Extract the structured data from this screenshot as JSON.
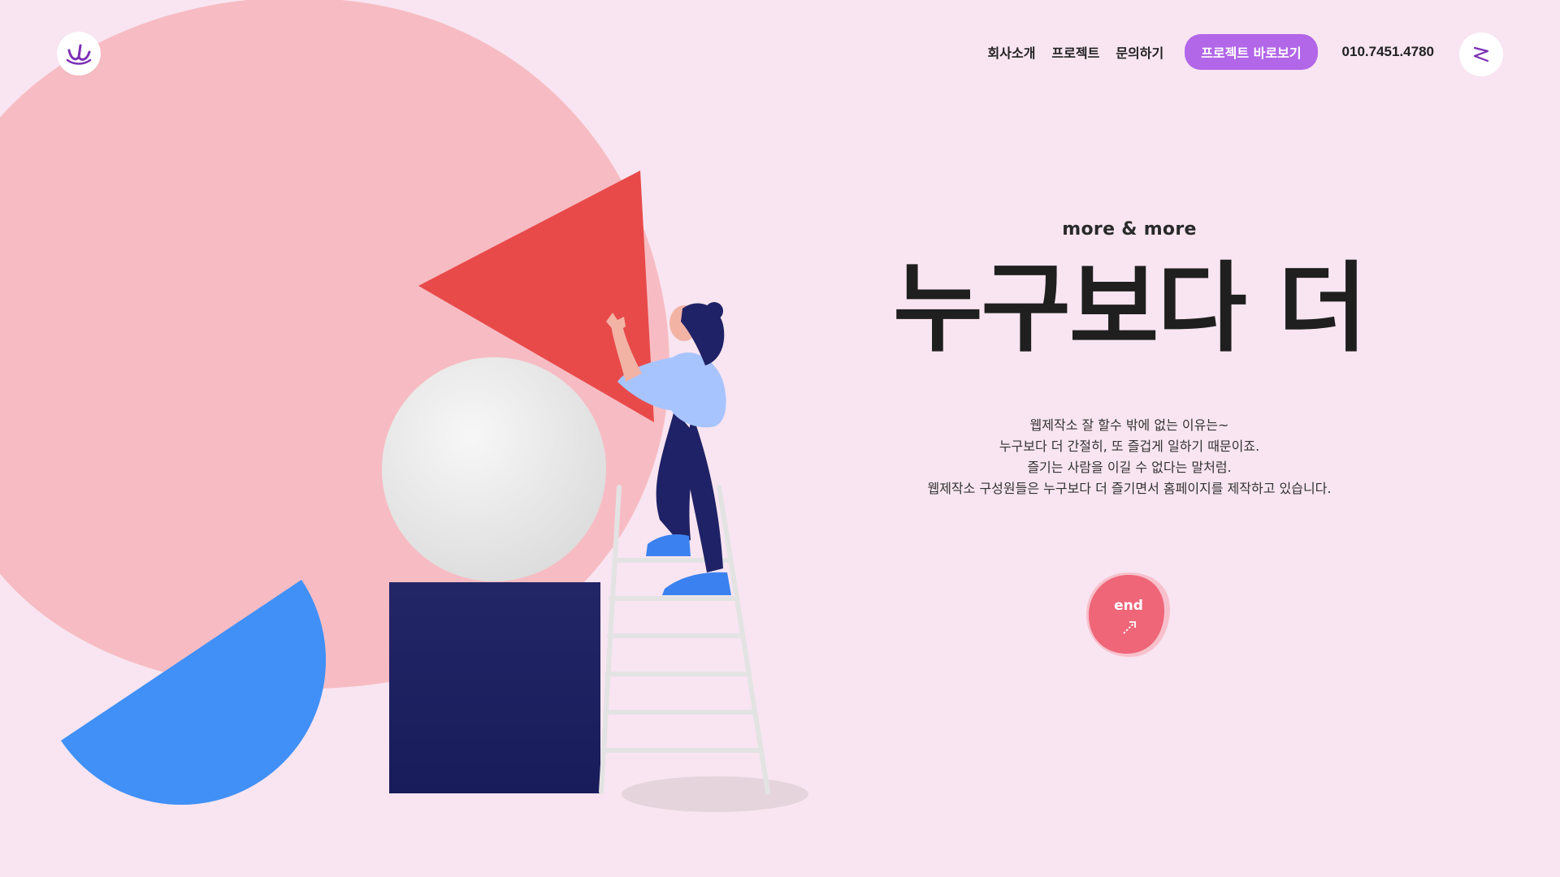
{
  "logo": {
    "icon": "smile-w-logo-icon",
    "color": "#7b2fb5"
  },
  "nav": {
    "links": [
      "회사소개",
      "프로젝트",
      "문의하기"
    ],
    "cta_label": "프로젝트 바로보기",
    "phone": "010.7451.4780"
  },
  "menu": {
    "icon": "zigzag-menu-icon"
  },
  "hero": {
    "eyebrow": "more & more",
    "headline": "누구보다 더",
    "desc": [
      "웹제작소 잘 할수 밖에 없는 이유는~",
      "누구보다 더 간절히, 또 즐겁게 일하기 때문이죠.",
      "즐기는 사람을 이길 수 없다는 말처럼.",
      "웹제작소 구성원들은 누구보다 더 즐기면서 홈페이지를 제작하고 있습니다."
    ],
    "end_button": {
      "label": "end",
      "icon": "arrow-up-right-icon"
    }
  },
  "colors": {
    "background": "#f8e5f1",
    "accent_purple": "#b266e8",
    "pink_blob": "#f7bcc3",
    "triangle": "#e84a4a",
    "navy": "#1f2266",
    "blue": "#4090f7",
    "end_button": "#ef6679"
  }
}
